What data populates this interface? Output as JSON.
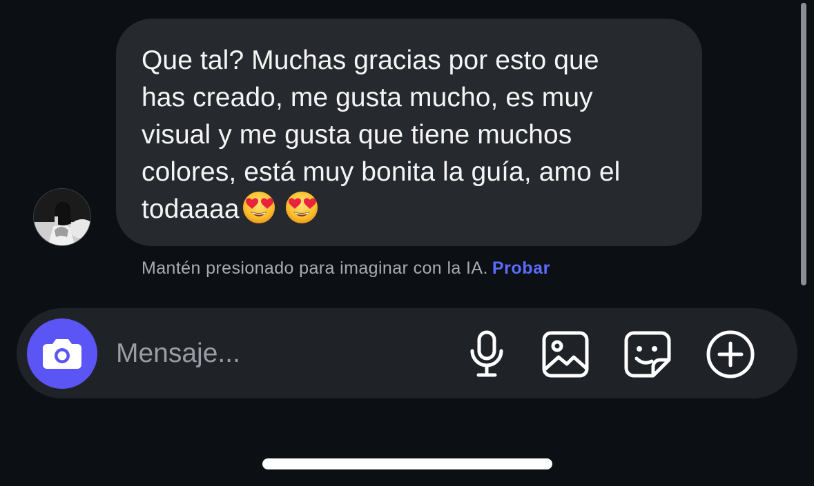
{
  "conversation": {
    "message": {
      "text": "Que tal? Muchas gracias por esto que\nhas creado, me gusta mucho, es muy\nvisual y me gusta que tiene muchos\ncolores, está muy bonita la guía, amo el\ntodaaaa",
      "emojis": [
        "smiling-face-with-heart-eyes",
        "smiling-face-with-heart-eyes"
      ],
      "sender_avatar_icon": "profile-photo"
    },
    "ai_hint": {
      "text": "Mantén presionado para imaginar con la IA.",
      "action_label": "Probar",
      "action_color": "#5b6cff"
    }
  },
  "composer": {
    "placeholder": "Mensaje...",
    "camera_icon": "camera-icon",
    "camera_button_color": "#5b55f5",
    "tools": [
      "microphone-icon",
      "image-gallery-icon",
      "sticker-icon",
      "add-circle-icon"
    ]
  },
  "theme": {
    "background": "#0c1014",
    "bubble": "#262a2f",
    "composer_bg": "#1f2328"
  }
}
